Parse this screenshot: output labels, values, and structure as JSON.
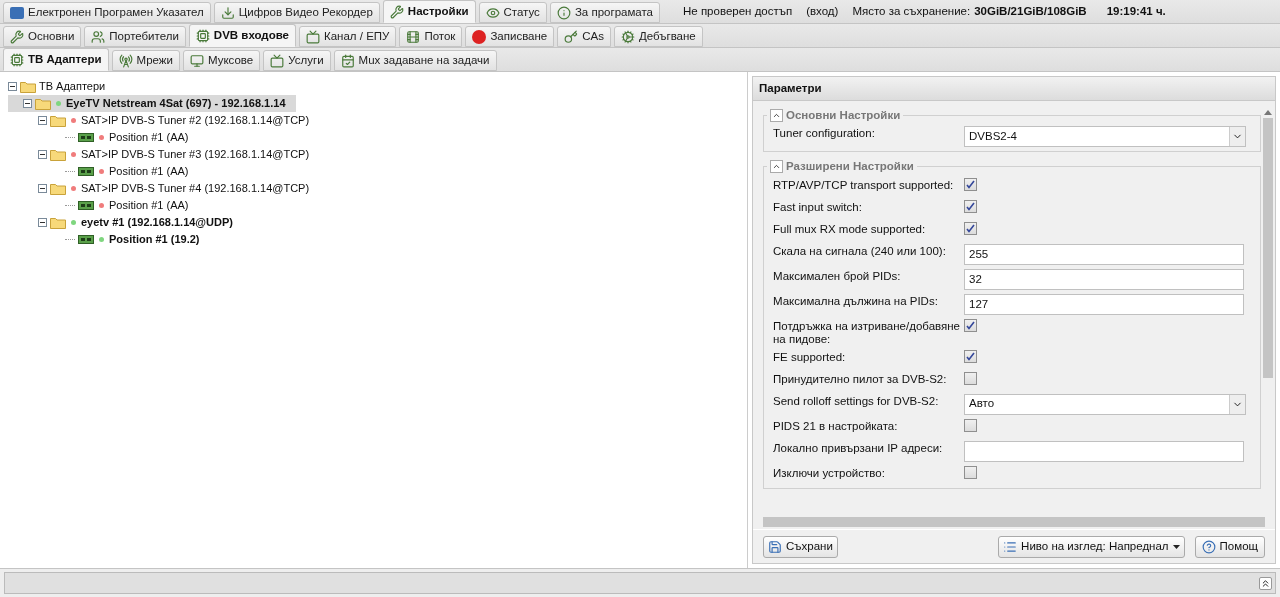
{
  "main_tabs": [
    {
      "label": "Електронен Програмен Указател",
      "selected": false
    },
    {
      "label": "Цифров Видео Рекордер",
      "selected": false
    },
    {
      "label": "Настройки",
      "selected": true
    },
    {
      "label": "Статус",
      "selected": false
    },
    {
      "label": "За програмата",
      "selected": false
    }
  ],
  "status": {
    "access": "Не проверен достъп",
    "login": "(вход)",
    "storage_label": "Място за съхранение:",
    "storage_value": "30GiB/21GiB/108GiB",
    "time": "19:19:41 ч."
  },
  "config_tabs": [
    {
      "label": "Основни",
      "selected": false
    },
    {
      "label": "Портебители",
      "selected": false
    },
    {
      "label": "DVB входове",
      "selected": true
    },
    {
      "label": "Канал / ЕПУ",
      "selected": false
    },
    {
      "label": "Поток",
      "selected": false
    },
    {
      "label": "Записване",
      "selected": false
    },
    {
      "label": "CAs",
      "selected": false
    },
    {
      "label": "Дебъгване",
      "selected": false
    }
  ],
  "dvb_tabs": [
    {
      "label": "ТВ Адаптери",
      "selected": true
    },
    {
      "label": "Мрежи",
      "selected": false
    },
    {
      "label": "Муксове",
      "selected": false
    },
    {
      "label": "Услуги",
      "selected": false
    },
    {
      "label": "Mux задаване на задачи",
      "selected": false
    }
  ],
  "tree": {
    "label": "ТВ Адаптери",
    "kind": "folder",
    "expanded": true,
    "selected": false,
    "children": [
      {
        "label": "EyeTV Netstream 4Sat (697) - 192.168.1.14",
        "kind": "folder",
        "bold": true,
        "color": "#7fd67f",
        "expanded": true,
        "selected": true,
        "children": [
          {
            "label": "SAT>IP DVB-S Tuner #2 (192.168.1.14@TCP)",
            "kind": "folder",
            "bold": false,
            "color": "#f07c7c",
            "expanded": true,
            "selected": false,
            "children": [
              {
                "label": "Position #1 (AA)",
                "kind": "adapter",
                "bold": false,
                "color": "#f07c7c",
                "selected": false
              }
            ]
          },
          {
            "label": "SAT>IP DVB-S Tuner #3 (192.168.1.14@TCP)",
            "kind": "folder",
            "bold": false,
            "color": "#f07c7c",
            "expanded": true,
            "selected": false,
            "children": [
              {
                "label": "Position #1 (AA)",
                "kind": "adapter",
                "bold": false,
                "color": "#f07c7c",
                "selected": false
              }
            ]
          },
          {
            "label": "SAT>IP DVB-S Tuner #4 (192.168.1.14@TCP)",
            "kind": "folder",
            "bold": false,
            "color": "#f07c7c",
            "expanded": true,
            "selected": false,
            "children": [
              {
                "label": "Position #1 (AA)",
                "kind": "adapter",
                "bold": false,
                "color": "#f07c7c",
                "selected": false
              }
            ]
          },
          {
            "label": "eyetv #1 (192.168.1.14@UDP)",
            "kind": "folder",
            "bold": true,
            "color": "#7fd67f",
            "expanded": true,
            "selected": false,
            "children": [
              {
                "label": "Position #1 (19.2)",
                "kind": "adapter",
                "bold": true,
                "color": "#7fd67f",
                "selected": false
              }
            ]
          }
        ]
      }
    ]
  },
  "params": {
    "title": "Параметри",
    "groups": [
      {
        "title": "Основни Настройки",
        "expanded": true,
        "fields": [
          {
            "kind": "select",
            "label": "Tuner configuration:",
            "value": "DVBS2-4"
          }
        ]
      },
      {
        "title": "Разширени Настройки",
        "expanded": true,
        "fields": [
          {
            "kind": "checkbox",
            "label": "RTP/AVP/TCP transport supported:",
            "checked": true
          },
          {
            "kind": "checkbox",
            "label": "Fast input switch:",
            "checked": true
          },
          {
            "kind": "checkbox",
            "label": "Full mux RX mode supported:",
            "checked": true
          },
          {
            "kind": "text",
            "label": "Скала на сигнала (240 или 100):",
            "value": "255"
          },
          {
            "kind": "text",
            "label": "Максимален брой PIDs:",
            "value": "32"
          },
          {
            "kind": "text",
            "label": "Максимална дължина на PIDs:",
            "value": "127"
          },
          {
            "kind": "checkbox",
            "label": "Потдръжка на изтриване/добавяне на пидове:",
            "checked": true
          },
          {
            "kind": "checkbox",
            "label": "FE supported:",
            "checked": true
          },
          {
            "kind": "checkbox",
            "label": "Принудително пилот за DVB-S2:",
            "checked": false
          },
          {
            "kind": "select",
            "label": "Send rolloff settings for DVB-S2:",
            "value": "Авто"
          },
          {
            "kind": "checkbox",
            "label": "PIDS 21 в настройката:",
            "checked": false
          },
          {
            "kind": "text",
            "label": "Локално привързани IP адреси:"
          },
          {
            "kind": "checkbox",
            "label": "Изключи устройство:",
            "checked": false
          }
        ]
      }
    ],
    "save": "Съхрани",
    "view_level": "Ниво на изглед: Напреднал",
    "help": "Помощ"
  }
}
